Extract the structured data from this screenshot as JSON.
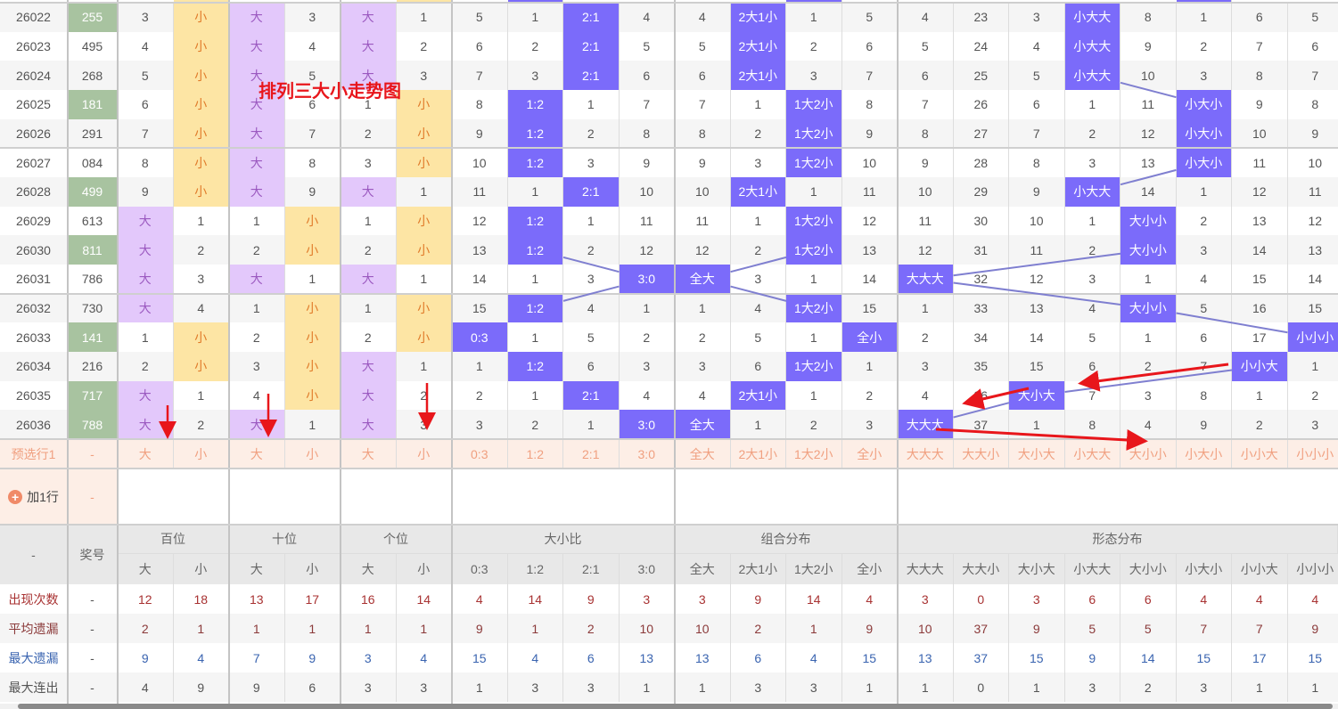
{
  "title_overlay": "排列三大小走势图",
  "header": {
    "corner": "-",
    "number": "奖号"
  },
  "groups": [
    {
      "label": "百位",
      "sub": [
        "大",
        "小"
      ]
    },
    {
      "label": "十位",
      "sub": [
        "大",
        "小"
      ]
    },
    {
      "label": "个位",
      "sub": [
        "大",
        "小"
      ]
    },
    {
      "label": "大小比",
      "sub": [
        "0:3",
        "1:2",
        "2:1",
        "3:0"
      ]
    },
    {
      "label": "组合分布",
      "sub": [
        "全大",
        "2大1小",
        "1大2小",
        "全小"
      ]
    },
    {
      "label": "形态分布",
      "sub": [
        "大大大",
        "大大小",
        "大小大",
        "小大大",
        "大小小",
        "小大小",
        "小小大",
        "小小小"
      ]
    }
  ],
  "rows": [
    {
      "period": "26022",
      "number": "255",
      "pair": true,
      "cells": [
        "3",
        "小",
        "大",
        "3",
        "大",
        "1",
        "5",
        "1",
        "2:1",
        "4",
        "4",
        "2大1小",
        "1",
        "5",
        "4",
        "23",
        "3",
        "小大大",
        "8",
        "1",
        "6",
        "5"
      ]
    },
    {
      "period": "26023",
      "number": "495",
      "pair": false,
      "cells": [
        "4",
        "小",
        "大",
        "4",
        "大",
        "2",
        "6",
        "2",
        "2:1",
        "5",
        "5",
        "2大1小",
        "2",
        "6",
        "5",
        "24",
        "4",
        "小大大",
        "9",
        "2",
        "7",
        "6"
      ]
    },
    {
      "period": "26024",
      "number": "268",
      "pair": false,
      "cells": [
        "5",
        "小",
        "大",
        "5",
        "大",
        "3",
        "7",
        "3",
        "2:1",
        "6",
        "6",
        "2大1小",
        "3",
        "7",
        "6",
        "25",
        "5",
        "小大大",
        "10",
        "3",
        "8",
        "7"
      ]
    },
    {
      "period": "26025",
      "number": "181",
      "pair": true,
      "cells": [
        "6",
        "小",
        "大",
        "6",
        "1",
        "小",
        "8",
        "1:2",
        "1",
        "7",
        "7",
        "1",
        "1大2小",
        "8",
        "7",
        "26",
        "6",
        "1",
        "11",
        "小大小",
        "9",
        "8"
      ]
    },
    {
      "period": "26026",
      "number": "291",
      "pair": false,
      "cells": [
        "7",
        "小",
        "大",
        "7",
        "2",
        "小",
        "9",
        "1:2",
        "2",
        "8",
        "8",
        "2",
        "1大2小",
        "9",
        "8",
        "27",
        "7",
        "2",
        "12",
        "小大小",
        "10",
        "9"
      ]
    },
    {
      "period": "26027",
      "number": "084",
      "pair": false,
      "cells": [
        "8",
        "小",
        "大",
        "8",
        "3",
        "小",
        "10",
        "1:2",
        "3",
        "9",
        "9",
        "3",
        "1大2小",
        "10",
        "9",
        "28",
        "8",
        "3",
        "13",
        "小大小",
        "11",
        "10"
      ]
    },
    {
      "period": "26028",
      "number": "499",
      "pair": true,
      "cells": [
        "9",
        "小",
        "大",
        "9",
        "大",
        "1",
        "11",
        "1",
        "2:1",
        "10",
        "10",
        "2大1小",
        "1",
        "11",
        "10",
        "29",
        "9",
        "小大大",
        "14",
        "1",
        "12",
        "11"
      ]
    },
    {
      "period": "26029",
      "number": "613",
      "pair": false,
      "cells": [
        "大",
        "1",
        "1",
        "小",
        "1",
        "小",
        "12",
        "1:2",
        "1",
        "11",
        "11",
        "1",
        "1大2小",
        "12",
        "11",
        "30",
        "10",
        "1",
        "大小小",
        "2",
        "13",
        "12"
      ]
    },
    {
      "period": "26030",
      "number": "811",
      "pair": true,
      "cells": [
        "大",
        "2",
        "2",
        "小",
        "2",
        "小",
        "13",
        "1:2",
        "2",
        "12",
        "12",
        "2",
        "1大2小",
        "13",
        "12",
        "31",
        "11",
        "2",
        "大小小",
        "3",
        "14",
        "13"
      ]
    },
    {
      "period": "26031",
      "number": "786",
      "pair": false,
      "cells": [
        "大",
        "3",
        "大",
        "1",
        "大",
        "1",
        "14",
        "1",
        "3",
        "3:0",
        "全大",
        "3",
        "1",
        "14",
        "大大大",
        "32",
        "12",
        "3",
        "1",
        "4",
        "15",
        "14"
      ]
    },
    {
      "period": "26032",
      "number": "730",
      "pair": false,
      "cells": [
        "大",
        "4",
        "1",
        "小",
        "1",
        "小",
        "15",
        "1:2",
        "4",
        "1",
        "1",
        "4",
        "1大2小",
        "15",
        "1",
        "33",
        "13",
        "4",
        "大小小",
        "5",
        "16",
        "15"
      ]
    },
    {
      "period": "26033",
      "number": "141",
      "pair": true,
      "cells": [
        "1",
        "小",
        "2",
        "小",
        "2",
        "小",
        "0:3",
        "1",
        "5",
        "2",
        "2",
        "5",
        "1",
        "全小",
        "2",
        "34",
        "14",
        "5",
        "1",
        "6",
        "17",
        "小小小"
      ]
    },
    {
      "period": "26034",
      "number": "216",
      "pair": false,
      "cells": [
        "2",
        "小",
        "3",
        "小",
        "大",
        "1",
        "1",
        "1:2",
        "6",
        "3",
        "3",
        "6",
        "1大2小",
        "1",
        "3",
        "35",
        "15",
        "6",
        "2",
        "7",
        "小小大",
        "1"
      ]
    },
    {
      "period": "26035",
      "number": "717",
      "pair": true,
      "cells": [
        "大",
        "1",
        "4",
        "小",
        "大",
        "2",
        "2",
        "1",
        "2:1",
        "4",
        "4",
        "2大1小",
        "1",
        "2",
        "4",
        "36",
        "大小大",
        "7",
        "3",
        "8",
        "1",
        "2"
      ]
    },
    {
      "period": "26036",
      "number": "788",
      "pair": true,
      "cells": [
        "大",
        "2",
        "大",
        "1",
        "大",
        "3",
        "3",
        "2",
        "1",
        "3:0",
        "全大",
        "1",
        "2",
        "3",
        "大大大",
        "37",
        "1",
        "8",
        "4",
        "9",
        "2",
        "3"
      ]
    }
  ],
  "preselect": {
    "label": "预选行1",
    "number": "-",
    "cells": [
      "大",
      "小",
      "大",
      "小",
      "大",
      "小",
      "0:3",
      "1:2",
      "2:1",
      "3:0",
      "全大",
      "2大1小",
      "1大2小",
      "全小",
      "大大大",
      "大大小",
      "大小大",
      "小大大",
      "大小小",
      "小大小",
      "小小大",
      "小小小"
    ]
  },
  "add_row": {
    "label": "加1行",
    "number": "-"
  },
  "stats": [
    {
      "label": "出现次数",
      "number": "-",
      "color": "#a83232",
      "values": [
        "12",
        "18",
        "13",
        "17",
        "16",
        "14",
        "4",
        "14",
        "9",
        "3",
        "3",
        "9",
        "14",
        "4",
        "3",
        "0",
        "3",
        "6",
        "6",
        "4",
        "4",
        "4"
      ]
    },
    {
      "label": "平均遗漏",
      "number": "-",
      "color": "#8b3a3a",
      "values": [
        "2",
        "1",
        "1",
        "1",
        "1",
        "1",
        "9",
        "1",
        "2",
        "10",
        "10",
        "2",
        "1",
        "9",
        "10",
        "37",
        "9",
        "5",
        "5",
        "7",
        "7",
        "9"
      ]
    },
    {
      "label": "最大遗漏",
      "number": "-",
      "color": "#3a64b0",
      "values": [
        "9",
        "4",
        "7",
        "9",
        "3",
        "4",
        "15",
        "4",
        "6",
        "13",
        "13",
        "6",
        "4",
        "15",
        "13",
        "37",
        "15",
        "9",
        "14",
        "15",
        "17",
        "15"
      ]
    },
    {
      "label": "最大连出",
      "number": "-",
      "color": "#555555",
      "values": [
        "4",
        "9",
        "9",
        "6",
        "3",
        "3",
        "1",
        "3",
        "3",
        "1",
        "1",
        "3",
        "3",
        "1",
        "1",
        "0",
        "1",
        "3",
        "2",
        "3",
        "1",
        "1"
      ]
    }
  ],
  "colors": {
    "highlight": "#7b6bfa",
    "big": "#e3c8fb",
    "small": "#fde5a4",
    "pair": "#a8c3a0",
    "trend_line": "#7f7fd0",
    "annotation": "#e8161b"
  }
}
